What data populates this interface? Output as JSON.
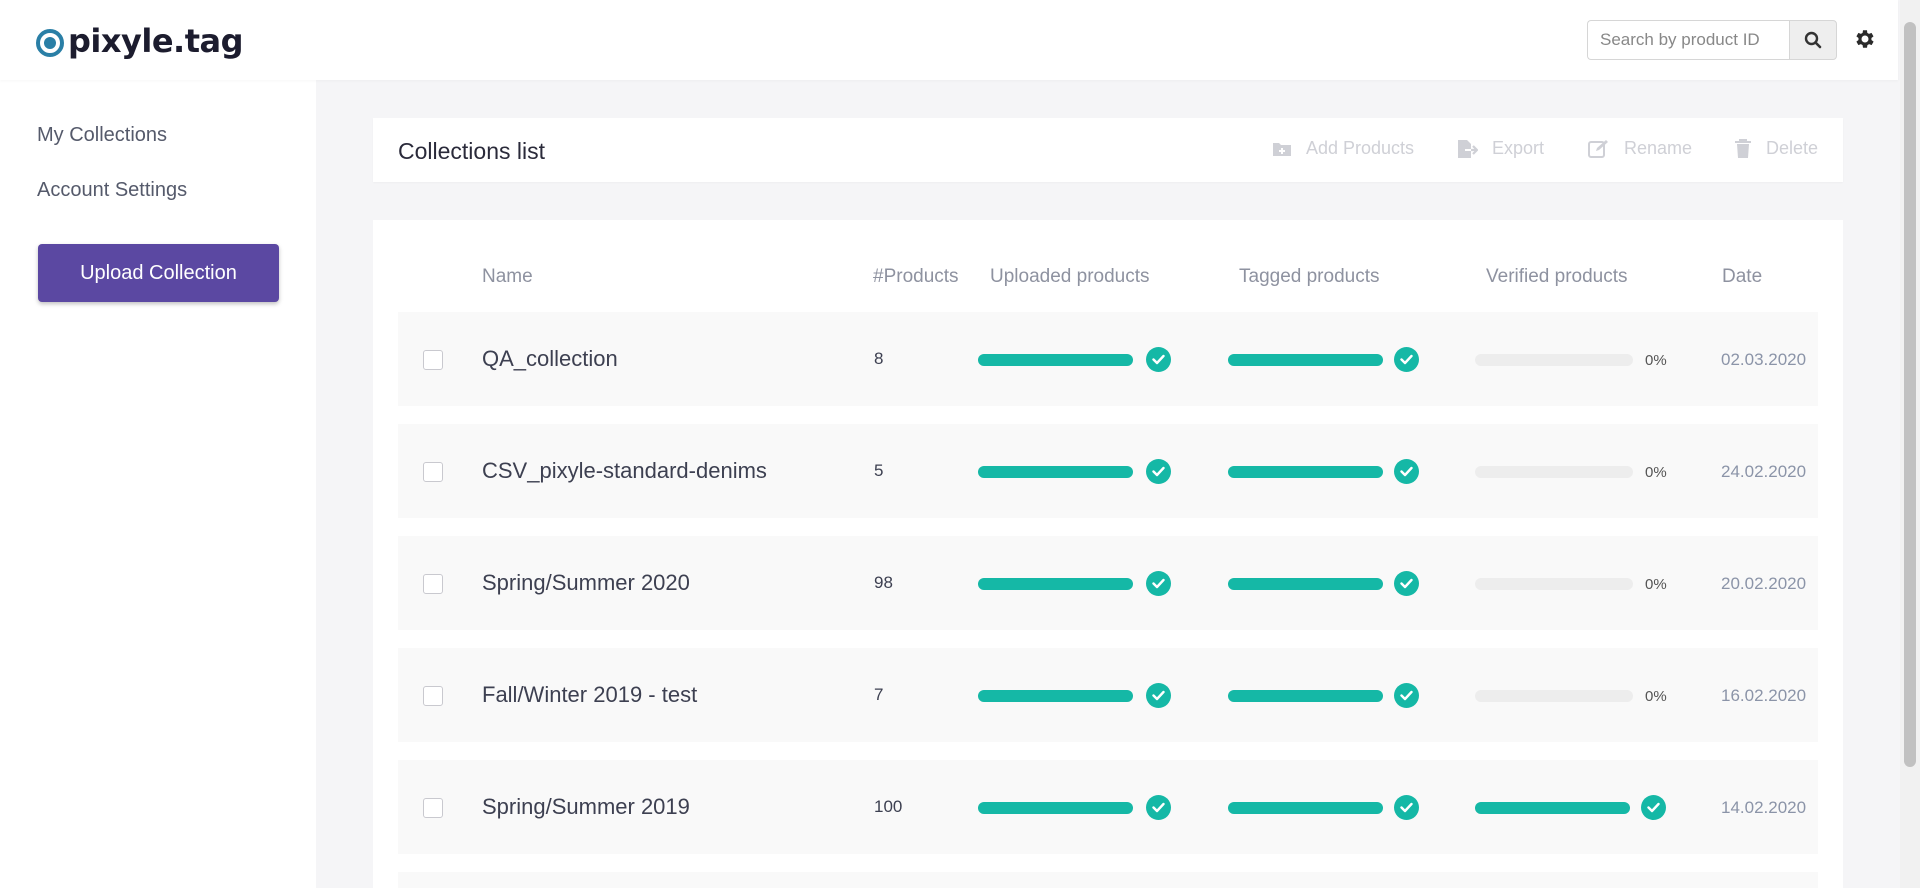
{
  "app": {
    "logo_text": "pixyle.tag"
  },
  "search": {
    "placeholder": "Search by product ID"
  },
  "sidebar": {
    "items": [
      {
        "label": "My Collections"
      },
      {
        "label": "Account Settings"
      }
    ],
    "upload_label": "Upload Collection"
  },
  "toolbar": {
    "title": "Collections list",
    "actions": [
      {
        "label": "Add Products",
        "icon": "folder-plus-icon"
      },
      {
        "label": "Export",
        "icon": "export-icon"
      },
      {
        "label": "Rename",
        "icon": "edit-icon"
      },
      {
        "label": "Delete",
        "icon": "trash-icon"
      }
    ]
  },
  "table": {
    "headers": {
      "name": "Name",
      "products": "#Products",
      "uploaded": "Uploaded products",
      "tagged": "Tagged products",
      "verified": "Verified products",
      "date": "Date"
    },
    "rows": [
      {
        "name": "QA_collection",
        "count": "8",
        "uploaded": 1,
        "tagged": 1,
        "verified": 0,
        "verified_label": "0%",
        "date": "02.03.2020"
      },
      {
        "name": "CSV_pixyle-standard-denims",
        "count": "5",
        "uploaded": 1,
        "tagged": 1,
        "verified": 0,
        "verified_label": "0%",
        "date": "24.02.2020"
      },
      {
        "name": "Spring/Summer 2020",
        "count": "98",
        "uploaded": 1,
        "tagged": 1,
        "verified": 0,
        "verified_label": "0%",
        "date": "20.02.2020"
      },
      {
        "name": "Fall/Winter 2019 - test",
        "count": "7",
        "uploaded": 1,
        "tagged": 1,
        "verified": 0,
        "verified_label": "0%",
        "date": "16.02.2020"
      },
      {
        "name": "Spring/Summer 2019",
        "count": "100",
        "uploaded": 1,
        "tagged": 1,
        "verified": 1,
        "verified_label": "",
        "date": "14.02.2020"
      }
    ]
  },
  "colors": {
    "accent": "#5b48a2",
    "progress": "#15b8a6",
    "logo": "#2a7fa6"
  }
}
